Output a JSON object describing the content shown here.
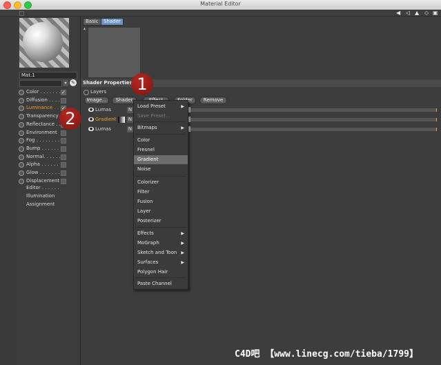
{
  "window": {
    "title": "Material Editor"
  },
  "material": {
    "name": "Mat.1",
    "channels": [
      {
        "label": "Color . . . . . . .",
        "checked": true
      },
      {
        "label": "Diffusion . . . .",
        "checked": false
      },
      {
        "label": "Luminance . . .",
        "checked": true
      },
      {
        "label": "Transparency",
        "checked": false
      },
      {
        "label": "Reflectance . . .",
        "checked": false
      },
      {
        "label": "Environment",
        "checked": false
      },
      {
        "label": "Fog . . . . . . . .",
        "checked": false
      },
      {
        "label": "Bump . . . . . . .",
        "checked": false
      },
      {
        "label": "Normal. . . . . .",
        "checked": false
      },
      {
        "label": "Alpha . . . . . .",
        "checked": false
      },
      {
        "label": "Glow . . . . . . .",
        "checked": false
      },
      {
        "label": "Displacement",
        "checked": false
      }
    ],
    "subitems": [
      "Editor . . . . . .",
      "Illumination",
      "Assignment"
    ],
    "check_mark": "✓"
  },
  "tabs": [
    "Basic",
    "Shader"
  ],
  "shader_properties": {
    "header": "Shader Properties",
    "layers_label": "Layers",
    "buttons": [
      "Image...",
      "Shader",
      "Effect",
      "Folder",
      "Remove"
    ],
    "rows": [
      {
        "name": "Lumas",
        "n": "N"
      },
      {
        "name": "Gradient",
        "n": "N"
      },
      {
        "name": "Lumas",
        "n": "N"
      }
    ]
  },
  "context_menu": {
    "items": [
      {
        "label": "Load Preset",
        "submenu": true,
        "disabled": false,
        "selected": false
      },
      {
        "label": "Save Preset...",
        "submenu": false,
        "disabled": true,
        "selected": false
      },
      {
        "label": "Bitmaps",
        "submenu": true,
        "disabled": false,
        "selected": false
      },
      {
        "label": "Color",
        "submenu": false,
        "disabled": false,
        "selected": false
      },
      {
        "label": "Fresnel",
        "submenu": false,
        "disabled": false,
        "selected": false
      },
      {
        "label": "Gradient",
        "submenu": false,
        "disabled": false,
        "selected": true
      },
      {
        "label": "Noise",
        "submenu": false,
        "disabled": false,
        "selected": false
      },
      {
        "label": "Colorizer",
        "submenu": false,
        "disabled": false,
        "selected": false
      },
      {
        "label": "Filter",
        "submenu": false,
        "disabled": false,
        "selected": false
      },
      {
        "label": "Fusion",
        "submenu": false,
        "disabled": false,
        "selected": false
      },
      {
        "label": "Layer",
        "submenu": false,
        "disabled": false,
        "selected": false
      },
      {
        "label": "Posterizer",
        "submenu": false,
        "disabled": false,
        "selected": false
      },
      {
        "label": "Effects",
        "submenu": true,
        "disabled": false,
        "selected": false
      },
      {
        "label": "MoGraph",
        "submenu": true,
        "disabled": false,
        "selected": false
      },
      {
        "label": "Sketch and Toon",
        "submenu": true,
        "disabled": false,
        "selected": false
      },
      {
        "label": "Surfaces",
        "submenu": true,
        "disabled": false,
        "selected": false
      },
      {
        "label": "Polygon Hair",
        "submenu": false,
        "disabled": false,
        "selected": false
      },
      {
        "label": "Paste Channel",
        "submenu": false,
        "disabled": false,
        "selected": false
      }
    ],
    "submenu_arrow": "▶"
  },
  "annotations": [
    "1",
    "2"
  ],
  "watermark": "C4D吧 【www.linecg.com/tieba/1799】",
  "colors": {
    "accent": "#f0a030",
    "selection": "#6b94c4",
    "badge": "#a6231c"
  },
  "icons": {
    "traffic_lights": [
      "close",
      "minimize",
      "zoom"
    ]
  }
}
